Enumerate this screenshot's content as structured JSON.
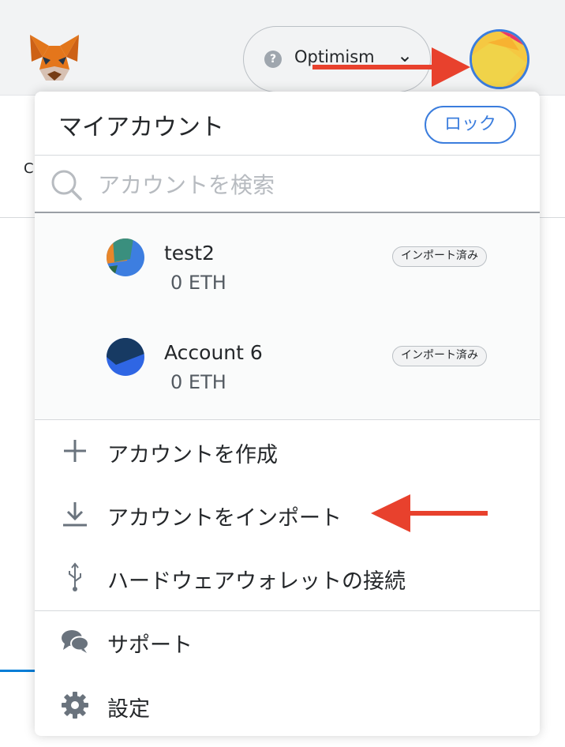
{
  "header": {
    "network": {
      "name": "Optimism",
      "help_glyph": "?",
      "chevron": "⌄"
    }
  },
  "background": {
    "partial_letter": "C"
  },
  "menu": {
    "title": "マイアカウント",
    "lock_label": "ロック",
    "search_placeholder": "アカウントを検索",
    "accounts": [
      {
        "name": "test2",
        "balance": "0 ETH",
        "badge": "インポート済み"
      },
      {
        "name": "Account 6",
        "balance": "0 ETH",
        "badge": "インポート済み"
      }
    ],
    "actions": [
      {
        "label": "アカウントを作成",
        "icon": "plus-icon"
      },
      {
        "label": "アカウントをインポート",
        "icon": "download-icon"
      },
      {
        "label": "ハードウェアウォレットの接続",
        "icon": "usb-icon"
      }
    ],
    "footer": [
      {
        "label": "サポート",
        "icon": "chat-bubbles-icon"
      },
      {
        "label": "設定",
        "icon": "gear-icon"
      }
    ]
  },
  "colors": {
    "accent": "#3b7ddd",
    "annotation_arrow": "#e8412d"
  }
}
